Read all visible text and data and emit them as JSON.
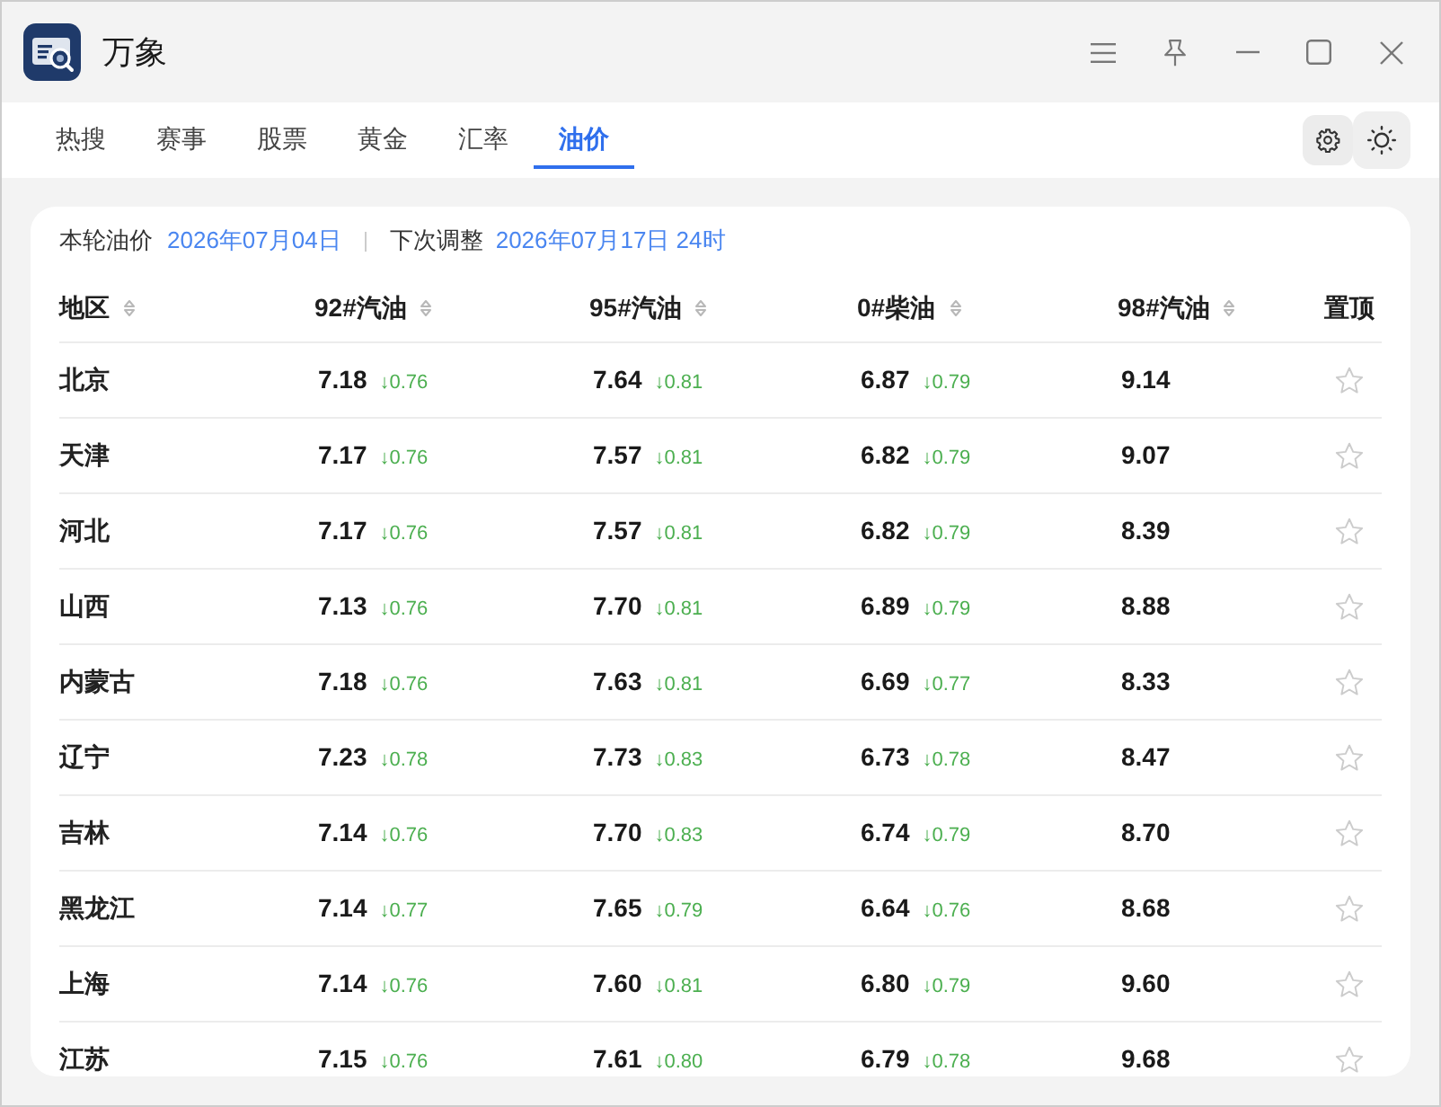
{
  "window": {
    "title": "万象"
  },
  "tabs": [
    {
      "label": "热搜",
      "selected": false
    },
    {
      "label": "赛事",
      "selected": false
    },
    {
      "label": "股票",
      "selected": false
    },
    {
      "label": "黄金",
      "selected": false
    },
    {
      "label": "汇率",
      "selected": false
    },
    {
      "label": "油价",
      "selected": true
    }
  ],
  "info": {
    "current_label": "本轮油价",
    "current_date": "2026年07月04日",
    "next_label": "下次调整",
    "next_date": "2026年07月17日 24时"
  },
  "table": {
    "columns": [
      {
        "label": "地区",
        "kind": "sortable"
      },
      {
        "label": "92#汽油",
        "kind": "sortable"
      },
      {
        "label": "95#汽油",
        "kind": "sortable"
      },
      {
        "label": "0#柴油",
        "kind": "sortable"
      },
      {
        "label": "98#汽油",
        "kind": "sortable"
      },
      {
        "label": "置顶",
        "kind": "plain"
      }
    ],
    "rows": [
      {
        "region": "北京",
        "prices": [
          {
            "value": "7.18",
            "change": "↓0.76"
          },
          {
            "value": "7.64",
            "change": "↓0.81"
          },
          {
            "value": "6.87",
            "change": "↓0.79"
          },
          {
            "value": "9.14"
          }
        ],
        "pinned": false
      },
      {
        "region": "天津",
        "prices": [
          {
            "value": "7.17",
            "change": "↓0.76"
          },
          {
            "value": "7.57",
            "change": "↓0.81"
          },
          {
            "value": "6.82",
            "change": "↓0.79"
          },
          {
            "value": "9.07"
          }
        ],
        "pinned": false
      },
      {
        "region": "河北",
        "prices": [
          {
            "value": "7.17",
            "change": "↓0.76"
          },
          {
            "value": "7.57",
            "change": "↓0.81"
          },
          {
            "value": "6.82",
            "change": "↓0.79"
          },
          {
            "value": "8.39"
          }
        ],
        "pinned": false
      },
      {
        "region": "山西",
        "prices": [
          {
            "value": "7.13",
            "change": "↓0.76"
          },
          {
            "value": "7.70",
            "change": "↓0.81"
          },
          {
            "value": "6.89",
            "change": "↓0.79"
          },
          {
            "value": "8.88"
          }
        ],
        "pinned": false
      },
      {
        "region": "内蒙古",
        "prices": [
          {
            "value": "7.18",
            "change": "↓0.76"
          },
          {
            "value": "7.63",
            "change": "↓0.81"
          },
          {
            "value": "6.69",
            "change": "↓0.77"
          },
          {
            "value": "8.33"
          }
        ],
        "pinned": false
      },
      {
        "region": "辽宁",
        "prices": [
          {
            "value": "7.23",
            "change": "↓0.78"
          },
          {
            "value": "7.73",
            "change": "↓0.83"
          },
          {
            "value": "6.73",
            "change": "↓0.78"
          },
          {
            "value": "8.47"
          }
        ],
        "pinned": false
      },
      {
        "region": "吉林",
        "prices": [
          {
            "value": "7.14",
            "change": "↓0.76"
          },
          {
            "value": "7.70",
            "change": "↓0.83"
          },
          {
            "value": "6.74",
            "change": "↓0.79"
          },
          {
            "value": "8.70"
          }
        ],
        "pinned": false
      },
      {
        "region": "黑龙江",
        "prices": [
          {
            "value": "7.14",
            "change": "↓0.77"
          },
          {
            "value": "7.65",
            "change": "↓0.79"
          },
          {
            "value": "6.64",
            "change": "↓0.76"
          },
          {
            "value": "8.68"
          }
        ],
        "pinned": false
      },
      {
        "region": "上海",
        "prices": [
          {
            "value": "7.14",
            "change": "↓0.76"
          },
          {
            "value": "7.60",
            "change": "↓0.81"
          },
          {
            "value": "6.80",
            "change": "↓0.79"
          },
          {
            "value": "9.60"
          }
        ],
        "pinned": false
      },
      {
        "region": "江苏",
        "prices": [
          {
            "value": "7.15",
            "change": "↓0.76"
          },
          {
            "value": "7.61",
            "change": "↓0.80"
          },
          {
            "value": "6.79",
            "change": "↓0.78"
          },
          {
            "value": "9.68"
          }
        ],
        "pinned": false
      }
    ]
  }
}
